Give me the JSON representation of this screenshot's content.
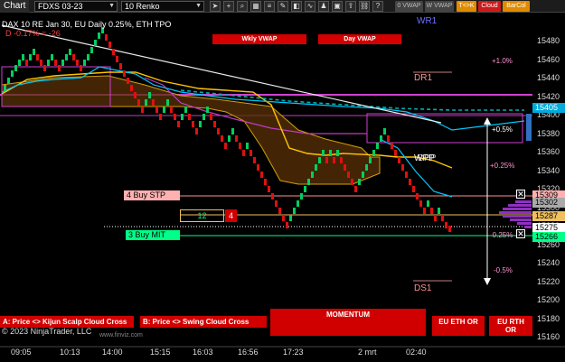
{
  "toolbar": {
    "chart_label": "Chart",
    "instrument": "FDXS 03-23",
    "bar_type": "10 Renko",
    "tags": [
      {
        "label": "0 VWAP",
        "bg": "#444444",
        "fg": "#bbbbbb"
      },
      {
        "label": "W VWAP",
        "bg": "#444444",
        "fg": "#bbbbbb"
      },
      {
        "label": "T<>K",
        "bg": "#e08a00",
        "fg": "#ffffff"
      },
      {
        "label": "Cloud",
        "bg": "#cc1a1a",
        "fg": "#ffffff"
      },
      {
        "label": "BarCol",
        "bg": "#e08a00",
        "fg": "#ffffff"
      }
    ]
  },
  "header": {
    "title": "DAX 10  RE Jan 30, EU Daily 0.25%, ETH TPO",
    "subtitle": "D -0.17% = -26"
  },
  "buttons": {
    "wkly_vwap": "Wkly VWAP",
    "day_vwap": "Day VWAP",
    "kijun": "A: Price <> Kijun Scalp Cloud Cross",
    "swing": "B: Price <> Swing Cloud Cross",
    "momentum": "MOMENTUM",
    "eu_eth": "EU ETH OR",
    "eu_rth": "EU RTH OR"
  },
  "copyright": "© 2023 NinjaTrader, LLC",
  "watermark": "www.finviz.com",
  "levels": {
    "wr1": "WR1",
    "dr1": "DR1",
    "ds1": "DS1",
    "wpp": "WPP",
    "dpp": "DPP",
    "pct_up1": "+1.0%",
    "pct_up05": "+0.5%",
    "pct_up025": "+0.25%",
    "pct_dn025": "-0.25%",
    "pct_dn05": "-0.5%"
  },
  "orders": {
    "stop_label": "4  Buy STP",
    "mit_label": "3  Buy MIT",
    "qty_value": "12",
    "qty_count": "4"
  },
  "price_axis": {
    "ticks": [
      "15480",
      "15460",
      "15440",
      "15420",
      "15400",
      "15380",
      "15360",
      "15340",
      "15320",
      "15300",
      "15280",
      "15260",
      "15240",
      "15220",
      "15200",
      "15180",
      "15160"
    ],
    "tags": [
      {
        "value": "15405",
        "bg": "#00aadd",
        "fg": "#ffffff"
      },
      {
        "value": "15309",
        "bg": "#ffb0b0",
        "fg": "#000000"
      },
      {
        "value": "15302",
        "bg": "#aaaaaa",
        "fg": "#000000"
      },
      {
        "value": "15287",
        "bg": "#f0c060",
        "fg": "#000000"
      },
      {
        "value": "15275",
        "bg": "#ffffff",
        "fg": "#000000"
      },
      {
        "value": "15266",
        "bg": "#00ff88",
        "fg": "#000000"
      }
    ]
  },
  "time_axis": {
    "labels": [
      "09:05",
      "10:13",
      "14:00",
      "15:15",
      "16:03",
      "16:56",
      "17:23",
      "2 mrt",
      "02:40"
    ]
  },
  "colors": {
    "up": "#00d060",
    "down": "#e01010",
    "tenkan": "#00c8ff",
    "kijun": "#ffc400",
    "cloud": "#c040c0"
  }
}
